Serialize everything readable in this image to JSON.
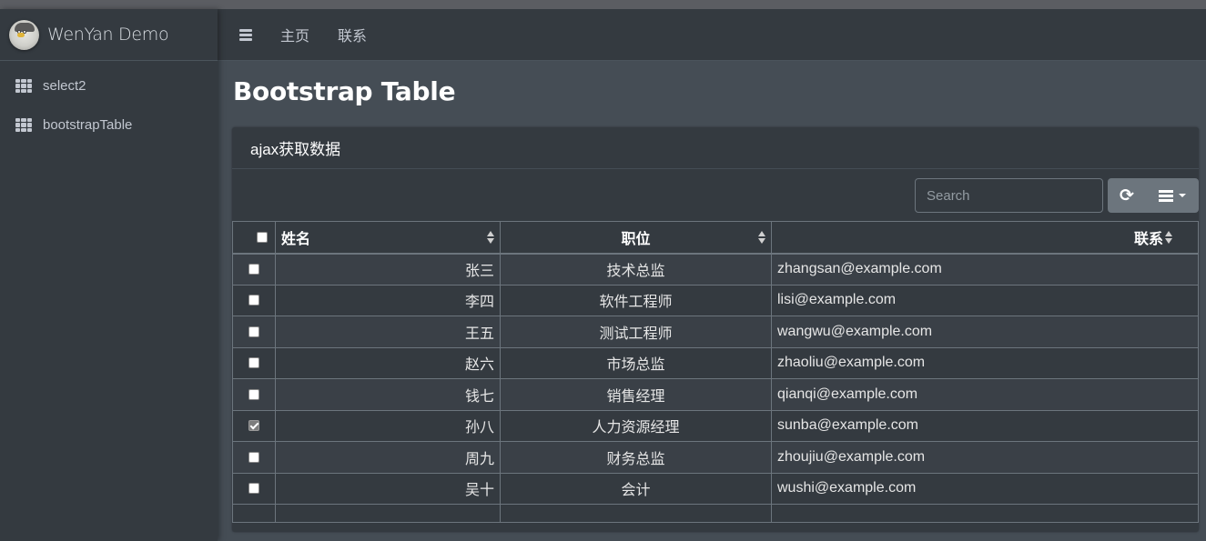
{
  "app": {
    "brand": "WenYan Demo",
    "brand_icon": "avatar-logo"
  },
  "sidebar": {
    "items": [
      {
        "label": "select2",
        "icon": "grid-icon"
      },
      {
        "label": "bootstrapTable",
        "icon": "grid-icon"
      }
    ]
  },
  "navbar": {
    "menu_icon": "hamburger-icon",
    "links": [
      {
        "label": "主页"
      },
      {
        "label": "联系"
      }
    ]
  },
  "page": {
    "title": "Bootstrap Table"
  },
  "card": {
    "title": "ajax获取数据",
    "search": {
      "placeholder": "Search",
      "value": ""
    },
    "buttons": {
      "refresh_icon": "refresh-icon",
      "columns_icon": "list-icon"
    }
  },
  "table": {
    "headers": {
      "select_all": false,
      "name": "姓名",
      "position": "职位",
      "contact": "联系"
    },
    "rows": [
      {
        "checked": false,
        "name": "张三",
        "position": "技术总监",
        "contact": "zhangsan@example.com"
      },
      {
        "checked": false,
        "name": "李四",
        "position": "软件工程师",
        "contact": "lisi@example.com"
      },
      {
        "checked": false,
        "name": "王五",
        "position": "测试工程师",
        "contact": "wangwu@example.com"
      },
      {
        "checked": false,
        "name": "赵六",
        "position": "市场总监",
        "contact": "zhaoliu@example.com"
      },
      {
        "checked": false,
        "name": "钱七",
        "position": "销售经理",
        "contact": "qianqi@example.com"
      },
      {
        "checked": true,
        "name": "孙八",
        "position": "人力资源经理",
        "contact": "sunba@example.com"
      },
      {
        "checked": false,
        "name": "周九",
        "position": "财务总监",
        "contact": "zhoujiu@example.com"
      },
      {
        "checked": false,
        "name": "吴十",
        "position": "会计",
        "contact": "wushi@example.com"
      }
    ]
  },
  "colors": {
    "sidebar_bg": "#343a40",
    "content_bg": "#454d55",
    "button_bg": "#6c757d"
  }
}
